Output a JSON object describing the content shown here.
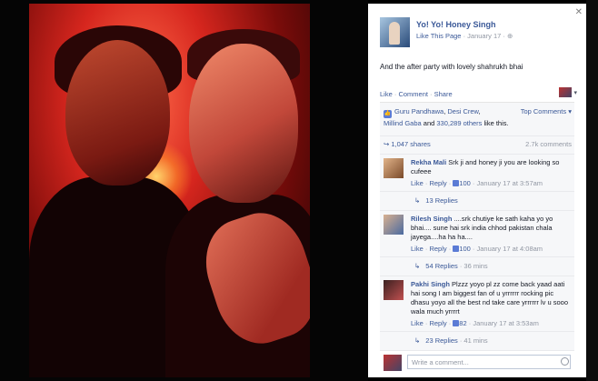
{
  "post": {
    "page_name": "Yo! Yo! Honey Singh",
    "like_page": "Like This Page",
    "date": "January 17",
    "status_text": "And the after party with lovely shahrukh bhai"
  },
  "actions": {
    "like": "Like",
    "comment": "Comment",
    "share": "Share",
    "sep": " · "
  },
  "ufi": {
    "likers_prefix": "",
    "likers": [
      "Guru Pandhawa",
      "Desi Crew",
      "Millind Gaba"
    ],
    "likers_and": " and ",
    "others": "330,289 others",
    "likes_suffix": " like this.",
    "top_comments": "Top Comments ▾",
    "shares": "1,047 shares",
    "comments_count": "2.7k comments"
  },
  "comments": [
    {
      "name": "Rekha Mali",
      "text": "Srk ji and honey ji you are looking so cufeee",
      "like": "Like",
      "reply": "Reply",
      "likes": "100",
      "time": "January 17 at 3:57am",
      "replies": "13 Replies",
      "replies_time": ""
    },
    {
      "name": "Rilesh Singh",
      "text": "....srk chutiye ke sath kaha yo yo bhai.... sune hai srk india chhod pakistan chala jayega....ha ha ha....",
      "like": "Like",
      "reply": "Reply",
      "likes": "100",
      "time": "January 17 at 4:08am",
      "replies": "54 Replies",
      "replies_time": "36 mins"
    },
    {
      "name": "Pakhi Singh",
      "text": "Plzzz yoyo pl zz come back yaad aati hai song I am biggest fan of u yrrrrrr rocking pic dhasu yoyo all the best nd take care yrrrrrr lv u sooo wala much yrrrrt",
      "like": "Like",
      "reply": "Reply",
      "likes": "82",
      "time": "January 17 at 3:53am",
      "replies": "23 Replies",
      "replies_time": "41 mins"
    }
  ],
  "composer": {
    "placeholder": "Write a comment..."
  },
  "icons": {
    "close": "close-icon",
    "globe": "globe-icon",
    "thumb": "thumbs-up-icon",
    "share": "share-icon",
    "emoji": "emoji-icon"
  },
  "colors": {
    "link": "#3b5998",
    "meta": "#9197a3",
    "panel_bg": "#ffffff",
    "ufi_bg": "#f6f7f9"
  }
}
